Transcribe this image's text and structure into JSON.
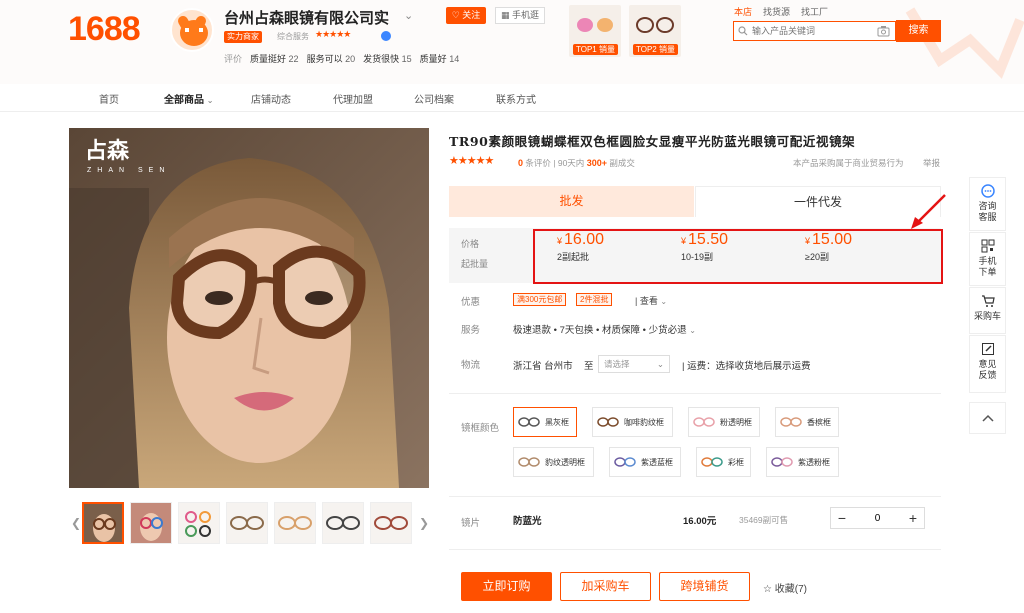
{
  "header": {
    "logo": "1688",
    "shop_name": "台州占森眼镜有限公司实",
    "badge_strength": "实力商家",
    "composite_label": "综合服务",
    "composite_stars": "★★★★★",
    "rating_label": "评价",
    "ratings": [
      {
        "label": "质量挺好",
        "count": "22"
      },
      {
        "label": "服务可以",
        "count": "20"
      },
      {
        "label": "发货很快",
        "count": "15"
      },
      {
        "label": "质量好",
        "count": "14"
      }
    ],
    "follow_label": "关注",
    "phone_label": "手机逛",
    "top_cards": [
      {
        "tag": "TOP1 销量"
      },
      {
        "tag": "TOP2 销量"
      }
    ],
    "scope_tabs": [
      "本店",
      "找货源",
      "找工厂"
    ],
    "search_placeholder": "输入产品关键词",
    "search_button": "搜索"
  },
  "nav": {
    "items": [
      "首页",
      "全部商品",
      "店铺动态",
      "代理加盟",
      "公司档案",
      "联系方式"
    ]
  },
  "gallery": {
    "watermark_brand": "占森",
    "watermark_sub": "ZHAN SEN"
  },
  "product": {
    "title": "TR90素颜眼镜蝴蝶框双色框圆脸女显瘦平光防蓝光眼镜可配近视镜架",
    "stars": "★★★★★",
    "review_count": "0",
    "review_label": "条评价",
    "sales_prefix": "90天内",
    "sales_count": "300+",
    "sales_suffix": "副成交",
    "business_note": "本产品采购属于商业贸易行为",
    "report_label": "举报",
    "tabs": {
      "wholesale": "批发",
      "dropship": "一件代发"
    },
    "price_label": "价格",
    "moq_label": "起批量",
    "currency": "¥",
    "tiers": [
      {
        "price": "16.00",
        "qty": "2副起批"
      },
      {
        "price": "15.50",
        "qty": "10-19副"
      },
      {
        "price": "15.00",
        "qty": "≥20副"
      }
    ],
    "promo_label": "优惠",
    "promos": [
      "满300元包邮",
      "2件混批"
    ],
    "view_more": "查看",
    "service_label": "服务",
    "service_text": "极速退款 • 7天包换 • 材质保障 • 少货必退",
    "logistics_label": "物流",
    "ship_from": "浙江省 台州市",
    "ship_to": "至",
    "ship_select_placeholder": "请选择",
    "freight_text": "运费：选择收货地后展示运费",
    "color_label": "镜框颜色",
    "colors": [
      "黑灰框",
      "咖啡豹纹框",
      "粉透明框",
      "香槟框",
      "豹纹透明框",
      "紫透蓝框",
      "彩框",
      "紫透粉框"
    ],
    "lens_label": "镜片",
    "lens_name": "防蓝光",
    "lens_price": "16.00元",
    "lens_stock": "35469副可售",
    "quantity": "0",
    "buy_now": "立即订购",
    "add_cart": "加采购车",
    "cross_border": "跨境铺货",
    "collect_label": "收藏(7)"
  },
  "float_bar": {
    "items": [
      "咨询客服",
      "手机下单",
      "采购车",
      "意见反馈"
    ]
  },
  "colors": {
    "brand": "#ff5000",
    "highlight_box": "#e41414"
  }
}
